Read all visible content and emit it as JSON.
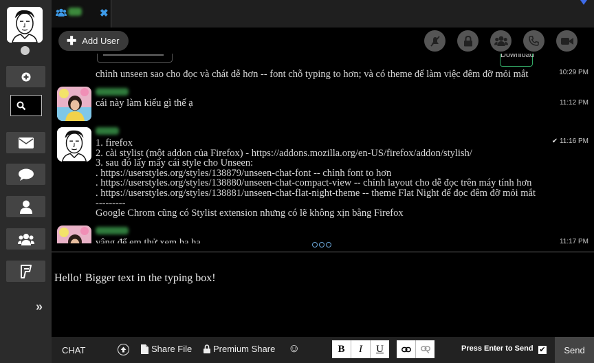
{
  "tab": {
    "close": "✖"
  },
  "toolbar": {
    "add_user_label": "Add User"
  },
  "file": {
    "download_label": "Download"
  },
  "messages": [
    {
      "time": "10:29 PM",
      "lines": [
        "chỉnh unseen sao cho đọc và chát dễ hơn -- font chỗ typing to hơn; và có theme để làm việc đêm đỡ mỏi mắt"
      ]
    },
    {
      "time": "11:12 PM",
      "lines": [
        "cái này làm kiểu gì thế ạ"
      ]
    },
    {
      "time": "11:16 PM",
      "lines": [
        "1. firefox",
        "2. cài stylist (một addon của Firefox) - https://addons.mozilla.org/en-US/firefox/addon/stylish/",
        "3. sau đó lấy mấy cái style cho Unseen:",
        ". https://userstyles.org/styles/138879/unseen-chat-font -- chỉnh font to hơn",
        ". https://userstyles.org/styles/138880/unseen-chat-compact-view -- chỉnh layout cho dễ đọc trên máy tính hơn",
        ". https://userstyles.org/styles/138881/unseen-chat-flat-night-theme -- theme Flat Night để đọc đêm đỡ mỏi mắt",
        "---------",
        "Google Chrom cũng có Stylist extension nhưng có lẽ không xịn bằng Firefox"
      ]
    },
    {
      "time": "11:17 PM",
      "lines": [
        "vâng để em thử xem ha ha"
      ]
    }
  ],
  "compose": {
    "text": "Hello! Bigger text in the typing box!"
  },
  "bottombar": {
    "chat_label": "CHAT",
    "share_file": "Share File",
    "premium_share": "Premium Share",
    "emoji": "☺",
    "bold": "B",
    "italic": "I",
    "underline": "U",
    "enter_to_send": "Press Enter to Send",
    "send": "Send"
  },
  "colors": {
    "accent": "#3d9be9",
    "sidebar": "#2b2b2b",
    "toolbar_button": "#555555"
  }
}
